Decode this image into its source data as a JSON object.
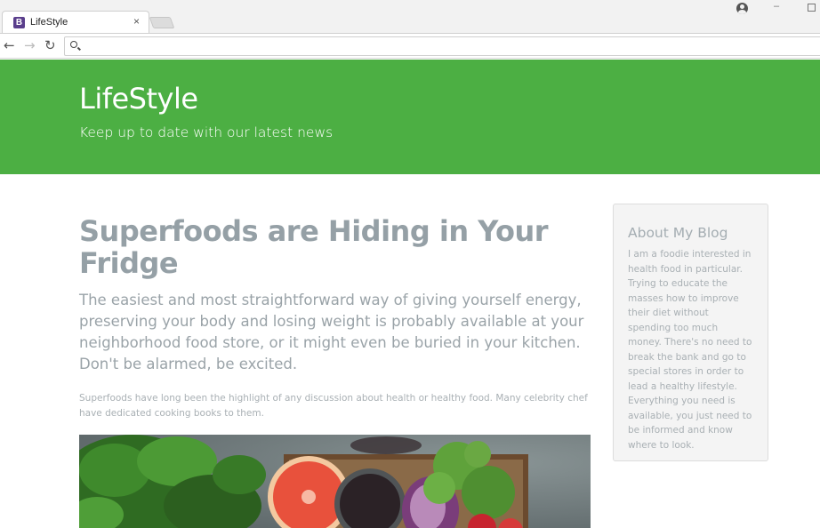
{
  "browser": {
    "tab_title": "LifeStyle",
    "favicon_letter": "B",
    "tab_close": "×",
    "address_value": "",
    "window_minimize": "–"
  },
  "header": {
    "title": "LifeStyle",
    "tagline": "Keep up to date with our latest news",
    "background_color": "#4caf43"
  },
  "article": {
    "title": "Superfoods are Hiding in Your Fridge",
    "lead": "The easiest and most straightforward way of giving yourself energy, preserving your body and losing weight is probably available at your neighborhood food store, or it might even be buried in your kitchen. Don't be alarmed, be excited.",
    "body": "Superfoods have long been the highlight of any discussion about health or healthy food. Many celebrity chef have dedicated cooking books to them."
  },
  "sidebar": {
    "heading": "About My Blog",
    "text": "I am a foodie interested in health food in particular. Trying to educate the masses how to improve their diet without spending too much money. There's no need to break the bank and go to special stores in order to lead a healthy lifestyle. Everything you need is available, you just need to be informed and know where to look."
  },
  "icons": {
    "back": "back-arrow-icon",
    "forward": "forward-arrow-icon",
    "reload": "reload-icon",
    "search": "search-icon",
    "profile": "profile-icon"
  }
}
